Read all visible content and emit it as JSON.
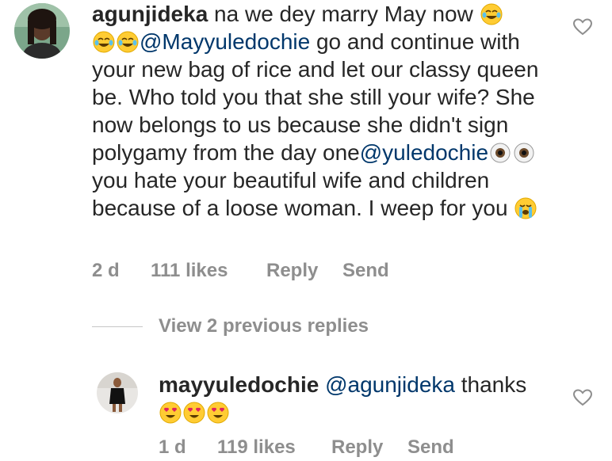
{
  "comment1": {
    "username": "agunjideka",
    "parts": {
      "p1": " na we dey marry May now ",
      "mention": "@Mayyuledochie",
      "p2": " go and continue with your new bag of rice and let our classy queen be. Who told you that she still your wife? She now belongs to us because she didn't sign polygamy from the day one",
      "mention2": "@yuledochie",
      "p3": " you hate your beautiful wife and children because of a loose woman. I weep for you "
    },
    "time": "2 d",
    "likes": "111 likes",
    "reply": "Reply",
    "send": "Send"
  },
  "view_replies": "View 2 previous replies",
  "comment2": {
    "username": "mayyuledochie",
    "mention": "@agunjideka",
    "text": " thanks",
    "time": "1 d",
    "likes": "119 likes",
    "reply": "Reply",
    "send": "Send"
  },
  "icons": {
    "like": "heart-outline-icon",
    "emoji_laugh": "tears-of-joy-emoji",
    "emoji_eye": "eye-emoji",
    "emoji_cry": "loudly-crying-emoji",
    "emoji_love": "heart-eyes-emoji"
  },
  "colors": {
    "text": "#262626",
    "meta": "#8e8e8e",
    "mention": "#00376b"
  }
}
